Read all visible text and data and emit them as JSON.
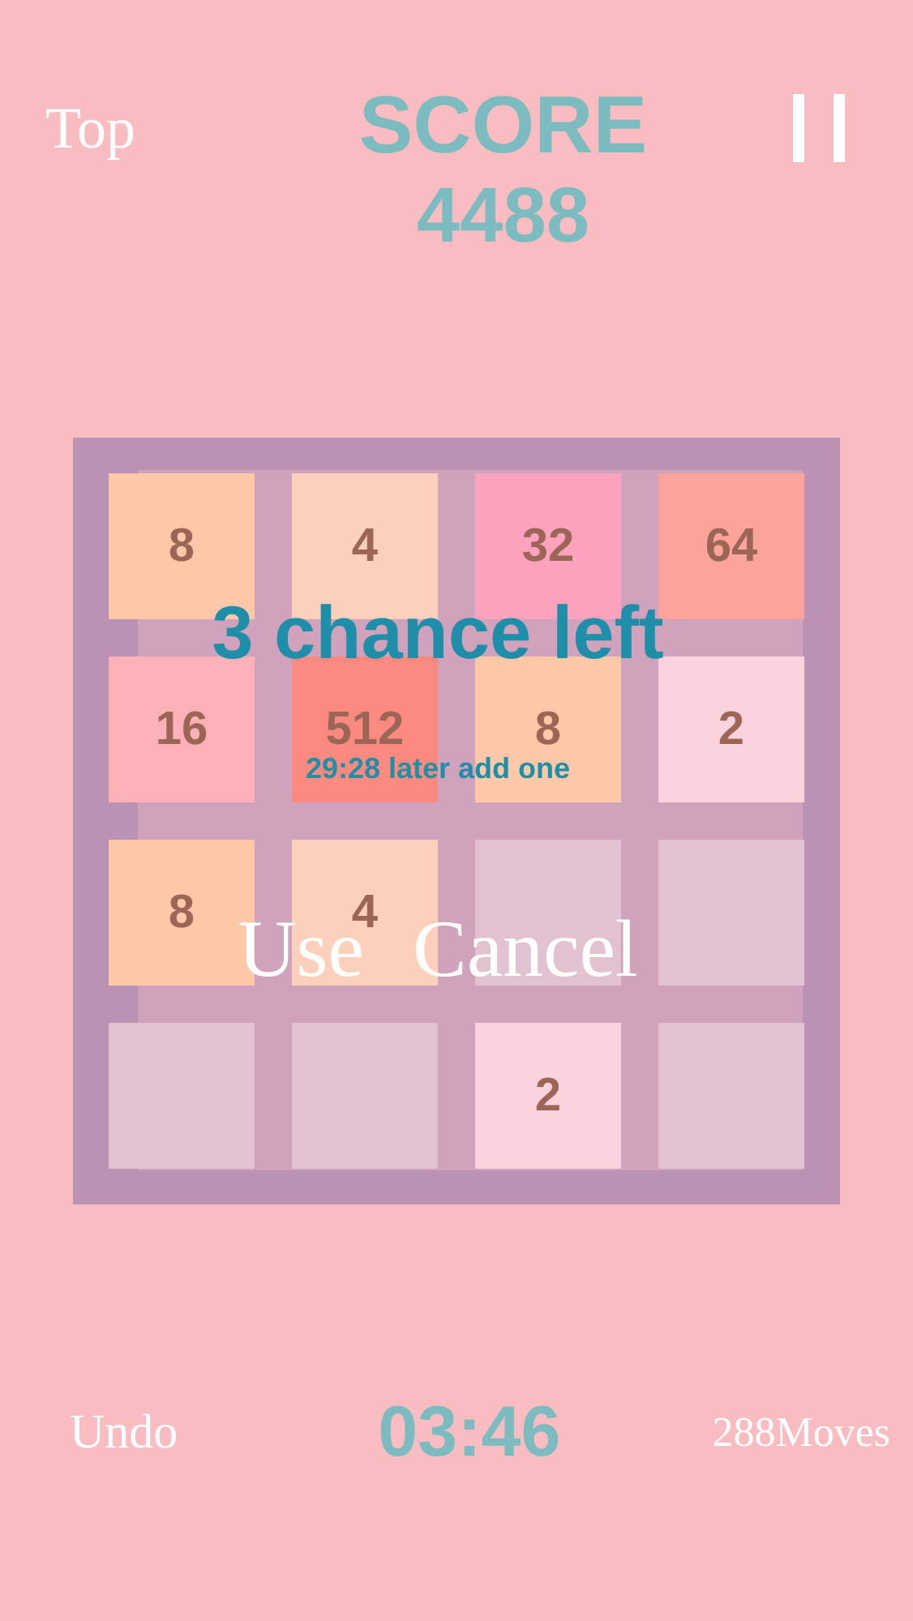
{
  "header": {
    "top_button": "Top",
    "score_label": "SCORE",
    "score": "4488"
  },
  "board": {
    "tiles": [
      {
        "kind": "tile",
        "value": "8",
        "color": "#fcc8a8"
      },
      {
        "kind": "tile",
        "value": "4",
        "color": "#fdd0bc"
      },
      {
        "kind": "tile",
        "value": "32",
        "color": "#fda2bc"
      },
      {
        "kind": "tile",
        "value": "64",
        "color": "#fca49c"
      },
      {
        "kind": "tile",
        "value": "16",
        "color": "#fcb0b8"
      },
      {
        "kind": "tile",
        "value": "512",
        "color": "#fa8a80"
      },
      {
        "kind": "tile",
        "value": "8",
        "color": "#fcc8a8"
      },
      {
        "kind": "tile",
        "value": "2",
        "color": "#fcd2de"
      },
      {
        "kind": "tile",
        "value": "8",
        "color": "#fcc8a8"
      },
      {
        "kind": "tile",
        "value": "4",
        "color": "#fdd0bc"
      },
      {
        "kind": "empty",
        "color": "#e2c2d0"
      },
      {
        "kind": "empty",
        "color": "#e2c2d0"
      },
      {
        "kind": "empty",
        "color": "#e2c2d0"
      },
      {
        "kind": "empty",
        "color": "#e2c2d0"
      },
      {
        "kind": "tile",
        "value": "2",
        "color": "#fcd2de"
      },
      {
        "kind": "empty",
        "color": "#e2c2d0"
      }
    ]
  },
  "dialog": {
    "title": "3 chance left",
    "subtitle": "29:28 later add one",
    "buttons": [
      "Use",
      "Cancel"
    ]
  },
  "footer": {
    "undo_button": "Undo",
    "timer": "03:46",
    "moves": "288Moves"
  }
}
